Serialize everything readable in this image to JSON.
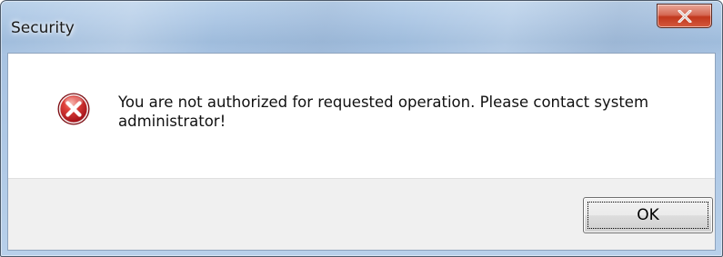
{
  "window": {
    "title": "Security"
  },
  "titlebar": {
    "close_icon": "close-icon"
  },
  "dialog": {
    "icon": "error-icon",
    "message": "You are not authorized for requested operation. Please contact system administrator!",
    "ok_label": "OK"
  },
  "colors": {
    "close_button": "#c83a1f",
    "error_icon": "#c8202a",
    "footer_background": "#f0f0f0"
  }
}
